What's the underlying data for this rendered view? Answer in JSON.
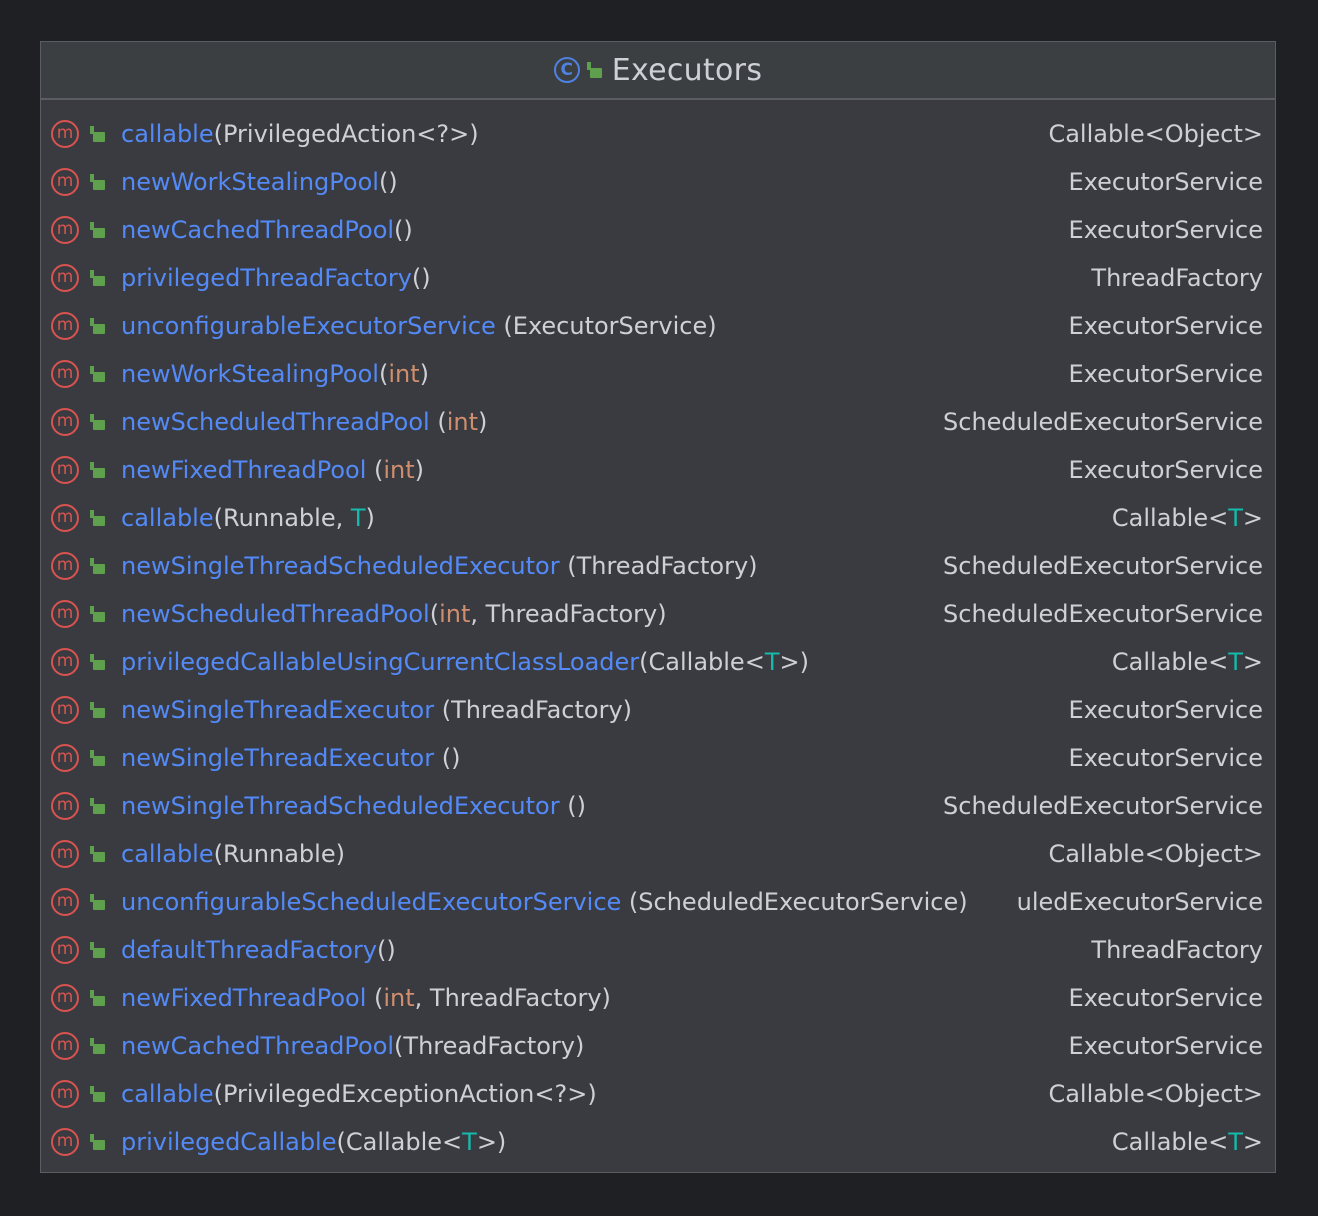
{
  "class": {
    "name": "Executors",
    "icon": "class-icon",
    "visibility_icon": "public-lock-icon"
  },
  "colors": {
    "background": "#1f2023",
    "card": "#393b40",
    "method_name": "#548af7",
    "text": "#ced0d6",
    "keyword": "#cf8e6d",
    "type_param": "#16baac",
    "method_icon": "#d9534f",
    "lock_icon": "#5fa04e",
    "class_icon": "#4f82e0"
  },
  "methods": [
    {
      "name": "callable",
      "params": [
        {
          "t": "p",
          "v": "(PrivilegedAction<?>)"
        }
      ],
      "ret": [
        {
          "t": "p",
          "v": "Callable<Object>"
        }
      ]
    },
    {
      "name": "newWorkStealingPool",
      "params": [
        {
          "t": "p",
          "v": "()"
        }
      ],
      "ret": [
        {
          "t": "p",
          "v": "ExecutorService"
        }
      ]
    },
    {
      "name": "newCachedThreadPool",
      "params": [
        {
          "t": "p",
          "v": "()"
        }
      ],
      "ret": [
        {
          "t": "p",
          "v": "ExecutorService"
        }
      ]
    },
    {
      "name": "privilegedThreadFactory",
      "params": [
        {
          "t": "p",
          "v": "()"
        }
      ],
      "ret": [
        {
          "t": "p",
          "v": "ThreadFactory"
        }
      ]
    },
    {
      "name": "unconfigurableExecutorService",
      "params": [
        {
          "t": "p",
          "v": " (ExecutorService)"
        }
      ],
      "ret": [
        {
          "t": "p",
          "v": "ExecutorService"
        }
      ]
    },
    {
      "name": "newWorkStealingPool",
      "params": [
        {
          "t": "p",
          "v": "("
        },
        {
          "t": "k",
          "v": "int"
        },
        {
          "t": "p",
          "v": ")"
        }
      ],
      "ret": [
        {
          "t": "p",
          "v": "ExecutorService"
        }
      ]
    },
    {
      "name": "newScheduledThreadPool",
      "params": [
        {
          "t": "p",
          "v": " ("
        },
        {
          "t": "k",
          "v": "int"
        },
        {
          "t": "p",
          "v": ")"
        }
      ],
      "ret": [
        {
          "t": "p",
          "v": "ScheduledExecutorService"
        }
      ]
    },
    {
      "name": "newFixedThreadPool",
      "params": [
        {
          "t": "p",
          "v": " ("
        },
        {
          "t": "k",
          "v": "int"
        },
        {
          "t": "p",
          "v": ")"
        }
      ],
      "ret": [
        {
          "t": "p",
          "v": "ExecutorService"
        }
      ]
    },
    {
      "name": "callable",
      "params": [
        {
          "t": "p",
          "v": "(Runnable, "
        },
        {
          "t": "g",
          "v": "T"
        },
        {
          "t": "p",
          "v": ")"
        }
      ],
      "ret": [
        {
          "t": "p",
          "v": "Callable<"
        },
        {
          "t": "g",
          "v": "T"
        },
        {
          "t": "p",
          "v": ">"
        }
      ]
    },
    {
      "name": "newSingleThreadScheduledExecutor",
      "params": [
        {
          "t": "p",
          "v": " (ThreadFactory)"
        }
      ],
      "ret": [
        {
          "t": "p",
          "v": "ScheduledExecutorService"
        }
      ]
    },
    {
      "name": "newScheduledThreadPool",
      "params": [
        {
          "t": "p",
          "v": "("
        },
        {
          "t": "k",
          "v": "int"
        },
        {
          "t": "p",
          "v": ", ThreadFactory)"
        }
      ],
      "ret": [
        {
          "t": "p",
          "v": "ScheduledExecutorService"
        }
      ]
    },
    {
      "name": "privilegedCallableUsingCurrentClassLoader",
      "params": [
        {
          "t": "p",
          "v": "(Callable<"
        },
        {
          "t": "g",
          "v": "T"
        },
        {
          "t": "p",
          "v": ">)"
        }
      ],
      "ret": [
        {
          "t": "p",
          "v": "Callable<"
        },
        {
          "t": "g",
          "v": "T"
        },
        {
          "t": "p",
          "v": ">"
        }
      ]
    },
    {
      "name": "newSingleThreadExecutor",
      "params": [
        {
          "t": "p",
          "v": " (ThreadFactory)"
        }
      ],
      "ret": [
        {
          "t": "p",
          "v": "ExecutorService"
        }
      ]
    },
    {
      "name": "newSingleThreadExecutor",
      "params": [
        {
          "t": "p",
          "v": " ()"
        }
      ],
      "ret": [
        {
          "t": "p",
          "v": "ExecutorService"
        }
      ]
    },
    {
      "name": "newSingleThreadScheduledExecutor",
      "params": [
        {
          "t": "p",
          "v": " ()"
        }
      ],
      "ret": [
        {
          "t": "p",
          "v": "ScheduledExecutorService"
        }
      ]
    },
    {
      "name": "callable",
      "params": [
        {
          "t": "p",
          "v": "(Runnable)"
        }
      ],
      "ret": [
        {
          "t": "p",
          "v": "Callable<Object>"
        }
      ]
    },
    {
      "name": "unconfigurableScheduledExecutorService",
      "params": [
        {
          "t": "p",
          "v": " (ScheduledExecutorService)"
        }
      ],
      "ret": [
        {
          "t": "p",
          "v": "uledExecutorService"
        }
      ]
    },
    {
      "name": "defaultThreadFactory",
      "params": [
        {
          "t": "p",
          "v": "()"
        }
      ],
      "ret": [
        {
          "t": "p",
          "v": "ThreadFactory"
        }
      ]
    },
    {
      "name": "newFixedThreadPool",
      "params": [
        {
          "t": "p",
          "v": " ("
        },
        {
          "t": "k",
          "v": "int"
        },
        {
          "t": "p",
          "v": ", ThreadFactory)"
        }
      ],
      "ret": [
        {
          "t": "p",
          "v": "ExecutorService"
        }
      ]
    },
    {
      "name": "newCachedThreadPool",
      "params": [
        {
          "t": "p",
          "v": "(ThreadFactory)"
        }
      ],
      "ret": [
        {
          "t": "p",
          "v": "ExecutorService"
        }
      ]
    },
    {
      "name": "callable",
      "params": [
        {
          "t": "p",
          "v": "(PrivilegedExceptionAction<?>)"
        }
      ],
      "ret": [
        {
          "t": "p",
          "v": "Callable<Object>"
        }
      ]
    },
    {
      "name": "privilegedCallable",
      "params": [
        {
          "t": "p",
          "v": "(Callable<"
        },
        {
          "t": "g",
          "v": "T"
        },
        {
          "t": "p",
          "v": ">)"
        }
      ],
      "ret": [
        {
          "t": "p",
          "v": "Callable<"
        },
        {
          "t": "g",
          "v": "T"
        },
        {
          "t": "p",
          "v": ">"
        }
      ]
    }
  ]
}
